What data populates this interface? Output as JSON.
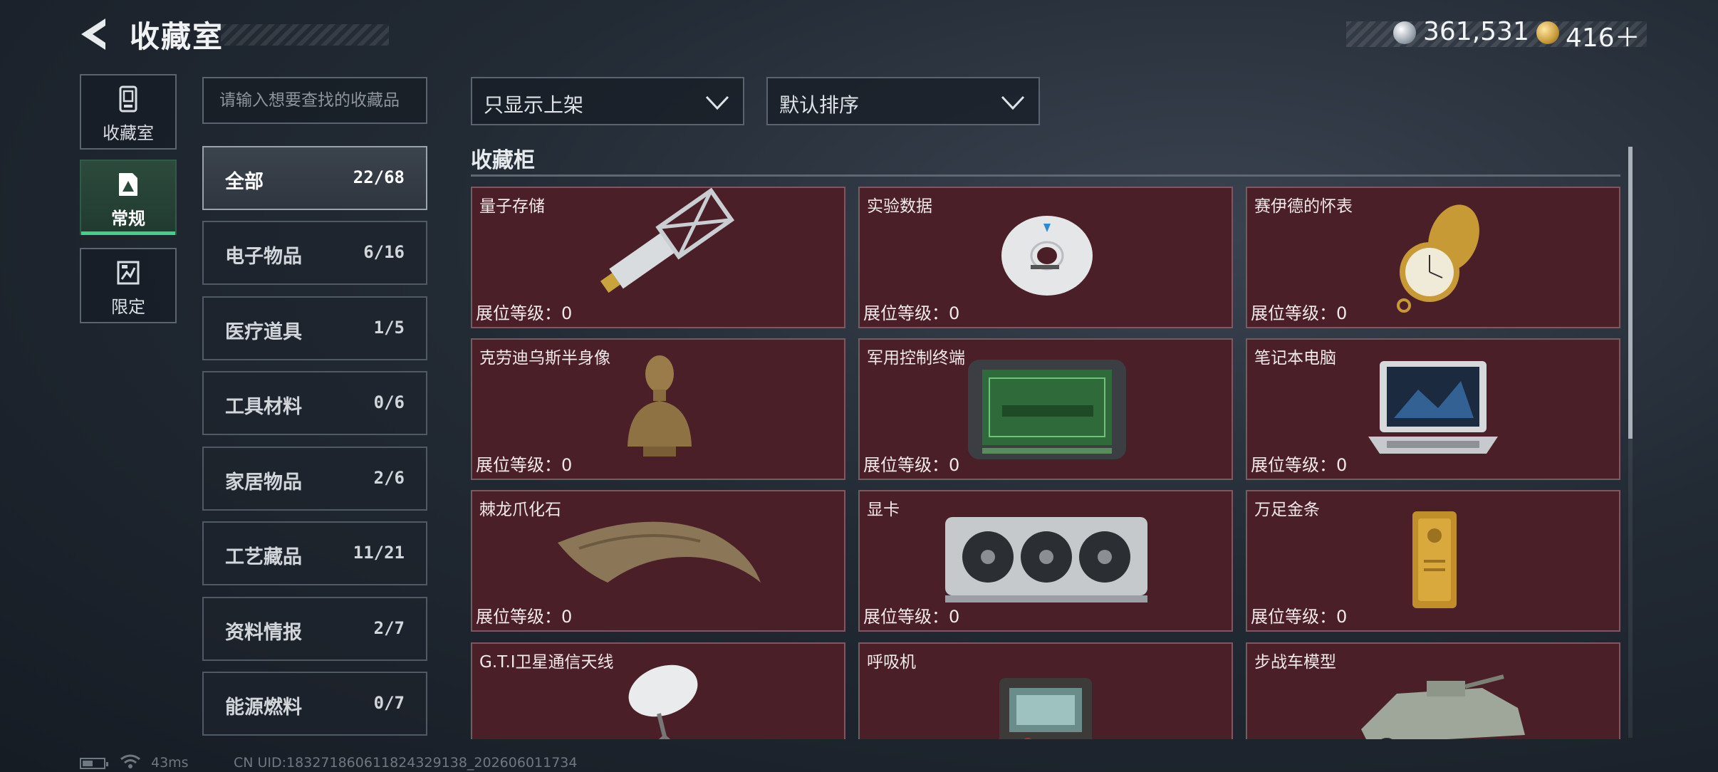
{
  "header": {
    "title": "收藏室",
    "currency_silver": "361,531",
    "currency_gold": "416＋",
    "currency_silver_icon": "silver-coin-icon",
    "currency_gold_icon": "gold-coin-icon"
  },
  "side_nav": [
    {
      "label": "收藏室",
      "icon": "display-case-icon",
      "active": false
    },
    {
      "label": "常规",
      "icon": "collection-card-icon",
      "active": true
    },
    {
      "label": "限定",
      "icon": "limited-card-icon",
      "active": false
    }
  ],
  "search": {
    "placeholder": "请输入想要查找的收藏品",
    "value": ""
  },
  "categories": [
    {
      "name": "全部",
      "count": "22/68",
      "active": true
    },
    {
      "name": "电子物品",
      "count": "6/16"
    },
    {
      "name": "医疗道具",
      "count": "1/5"
    },
    {
      "name": "工具材料",
      "count": "0/6"
    },
    {
      "name": "家居物品",
      "count": "2/6"
    },
    {
      "name": "工艺藏品",
      "count": "11/21"
    },
    {
      "name": "资料情报",
      "count": "2/7"
    },
    {
      "name": "能源燃料",
      "count": "0/7"
    }
  ],
  "filters": {
    "shelf_filter": "只显示上架",
    "sort": "默认排序"
  },
  "section": {
    "title": "收藏柜"
  },
  "items": [
    {
      "name": "量子存储",
      "level": "展位等级：0",
      "icon": "usb-drive-icon"
    },
    {
      "name": "实验数据",
      "level": "展位等级：0",
      "icon": "disc-icon"
    },
    {
      "name": "赛伊德的怀表",
      "level": "展位等级：0",
      "icon": "pocket-watch-icon"
    },
    {
      "name": "克劳迪乌斯半身像",
      "level": "展位等级：0",
      "icon": "bust-statue-icon"
    },
    {
      "name": "军用控制终端",
      "level": "展位等级：0",
      "icon": "control-terminal-icon"
    },
    {
      "name": "笔记本电脑",
      "level": "展位等级：0",
      "icon": "laptop-icon"
    },
    {
      "name": "棘龙爪化石",
      "level": "展位等级：0",
      "icon": "claw-fossil-icon"
    },
    {
      "name": "显卡",
      "level": "展位等级：0",
      "icon": "graphics-card-icon"
    },
    {
      "name": "万足金条",
      "level": "展位等级：0",
      "icon": "gold-bar-icon"
    },
    {
      "name": "G.T.I卫星通信天线",
      "level": "",
      "icon": "satellite-dish-icon"
    },
    {
      "name": "呼吸机",
      "level": "",
      "icon": "ventilator-icon"
    },
    {
      "name": "步战车模型",
      "level": "",
      "icon": "armored-vehicle-model-icon"
    }
  ],
  "status": {
    "ping": "43ms",
    "uid": "CN UID:18327186061182432913​8_202606011734",
    "battery_level": 0.5
  },
  "colors": {
    "card_bg": "#4b1f27",
    "active_accent": "#3fd28c"
  }
}
